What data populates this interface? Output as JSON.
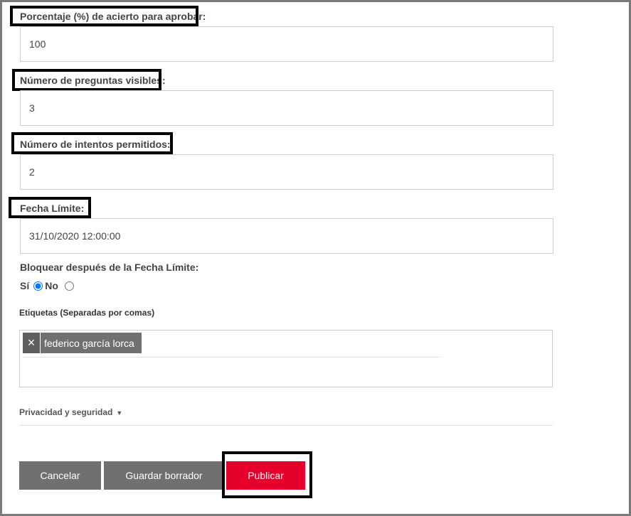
{
  "form": {
    "pass_percentage": {
      "label": "Porcentaje (%) de acierto para aprobar:",
      "value": "100"
    },
    "visible_questions": {
      "label": "Número de preguntas visibles:",
      "value": "3"
    },
    "allowed_attempts": {
      "label": "Número de intentos permitidos:",
      "value": "2"
    },
    "deadline": {
      "label": "Fecha Límite:",
      "value": "31/10/2020 12:00:00"
    },
    "lock_after_deadline": {
      "label": "Bloquear después de la Fecha Límite:",
      "options": [
        {
          "label": "Sí",
          "checked": true
        },
        {
          "label": "No",
          "checked": false
        }
      ]
    },
    "tags": {
      "label": "Etiquetas (Separadas por comas)",
      "remove_glyph": "×",
      "items": [
        "federico garcía lorca"
      ]
    },
    "privacy": {
      "label": "Privacidad y seguridad",
      "caret": "▼"
    }
  },
  "actions": {
    "cancel_label": "Cancelar",
    "draft_label": "Guardar borrador",
    "publish_label": "Publicar"
  },
  "colors": {
    "publish": "#e4002b",
    "secondary_button": "#707070",
    "highlight_border": "#000000"
  }
}
